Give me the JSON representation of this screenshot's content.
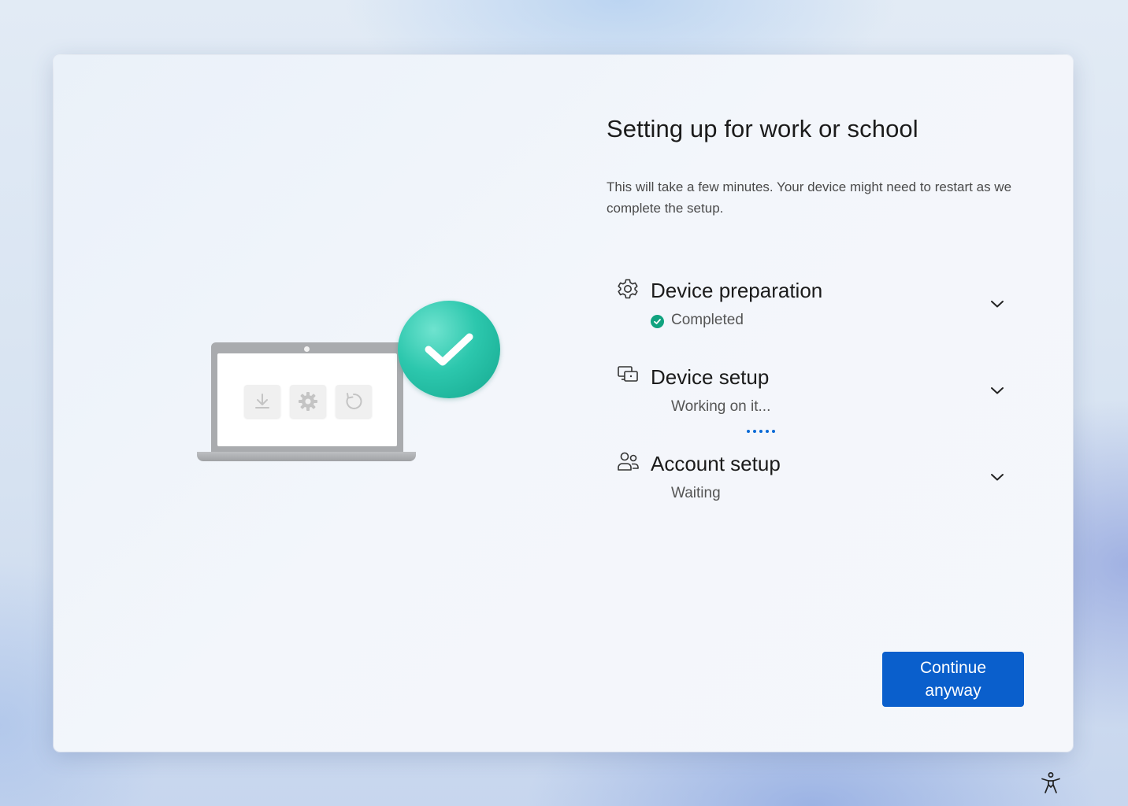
{
  "setup": {
    "title": "Setting up for work or school",
    "description": "This will take a few minutes. Your device might need to restart as we complete the setup.",
    "steps": [
      {
        "title": "Device preparation",
        "status": "Completed",
        "icon": "gear-icon"
      },
      {
        "title": "Device setup",
        "status": "Working on it...",
        "icon": "devices-icon"
      },
      {
        "title": "Account setup",
        "status": "Waiting",
        "icon": "people-icon"
      }
    ],
    "continue_label": "Continue anyway"
  },
  "illustration": {
    "icons": [
      "download-icon",
      "gear-icon",
      "refresh-icon",
      "checkmark-icon"
    ]
  },
  "colors": {
    "accent": "#0a5fcc",
    "success": "#10a37f",
    "progress_dots": "#0a6ad6"
  }
}
